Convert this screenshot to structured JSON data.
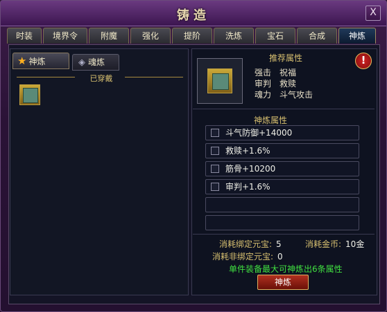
{
  "window": {
    "title": "铸造",
    "close_label": "X"
  },
  "tabs": [
    {
      "label": "时装"
    },
    {
      "label": "境界令"
    },
    {
      "label": "附魔"
    },
    {
      "label": "强化"
    },
    {
      "label": "提阶"
    },
    {
      "label": "洗炼"
    },
    {
      "label": "宝石"
    },
    {
      "label": "合成"
    },
    {
      "label": "神炼"
    }
  ],
  "active_tab": "神炼",
  "subtabs": {
    "active": "神炼",
    "inactive": "魂炼"
  },
  "equipped_section": {
    "label": "已穿戴"
  },
  "recommended": {
    "title": "推荐属性",
    "rows": [
      {
        "a": "强击",
        "b": "祝福"
      },
      {
        "a": "审判",
        "b": "救赎"
      },
      {
        "a": "魂力",
        "b": "斗气攻击"
      }
    ],
    "alert_label": "!"
  },
  "divine_attrs": {
    "title": "神炼属性",
    "items": [
      "斗气防御+14000",
      "救赎+1.6%",
      "筋骨+10200",
      "审判+1.6%"
    ],
    "empty_slots": 2
  },
  "costs": {
    "bound_label": "消耗绑定元宝:",
    "bound_value": "5",
    "gold_label": "消耗金币:",
    "gold_value": "10金",
    "unbound_label": "消耗非绑定元宝:",
    "unbound_value": "0"
  },
  "hint": "单件装备最大可神炼出6条属性",
  "action_button": "神炼",
  "colors": {
    "accent_gold": "#d8c070",
    "hint_green": "#40e040",
    "button_red": "#b03020"
  }
}
